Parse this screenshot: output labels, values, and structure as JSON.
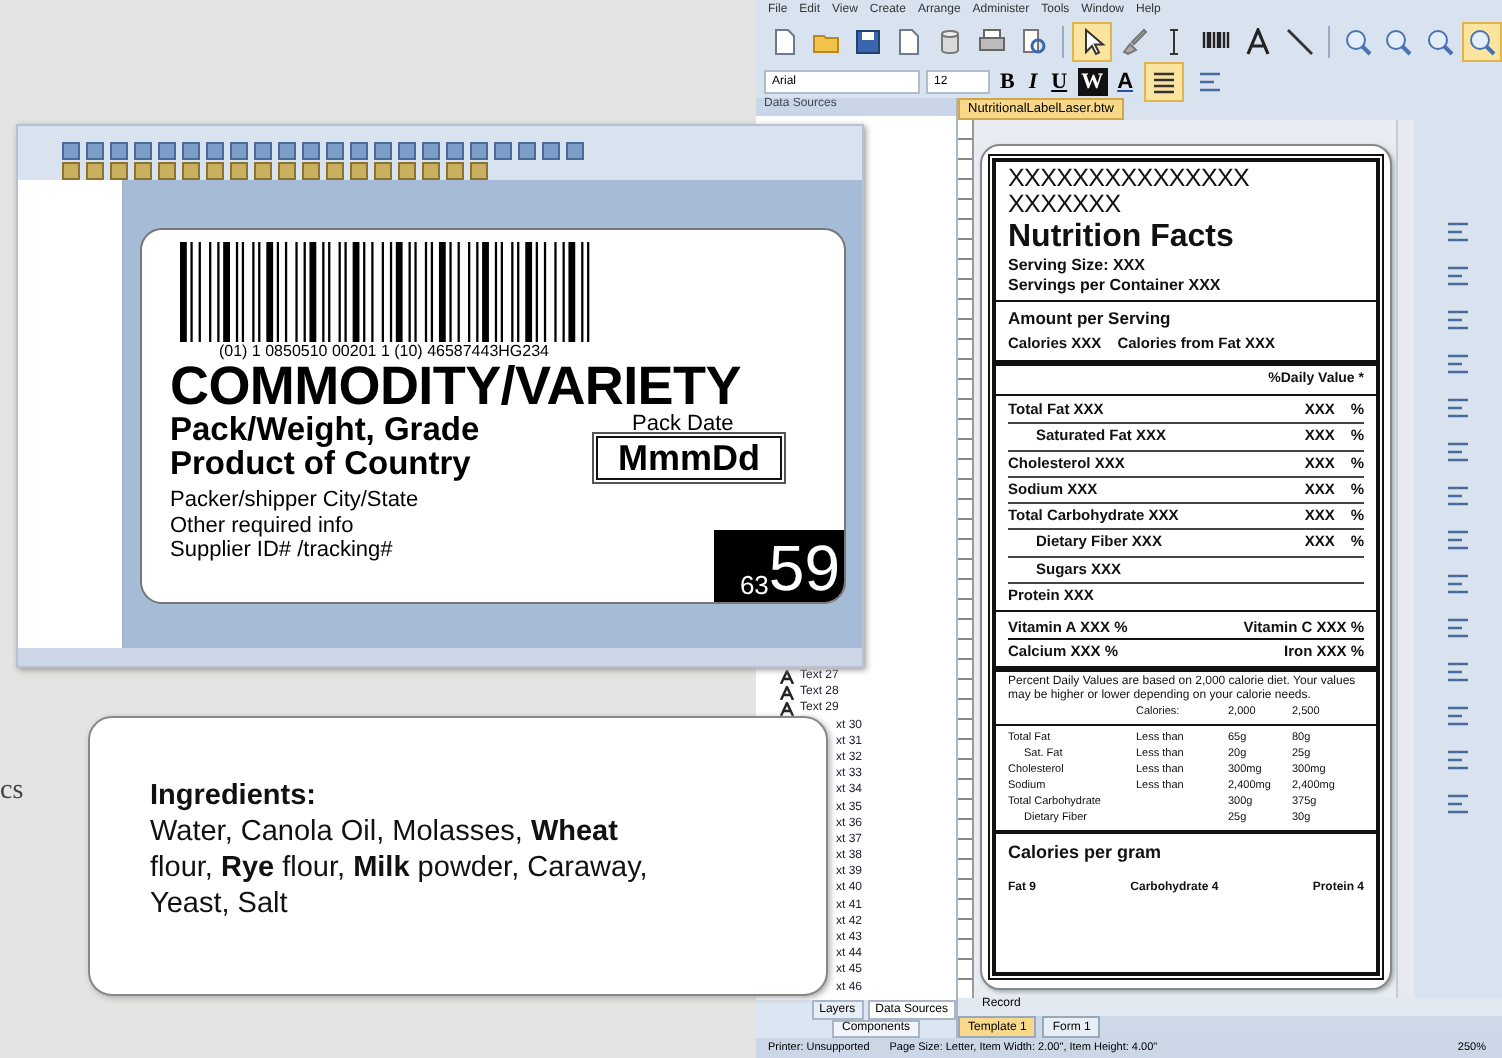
{
  "margin_text": "cs",
  "designer_window": {
    "menu": [
      "File",
      "Edit",
      "View",
      "Create",
      "Arrange",
      "Administer",
      "Tools",
      "Window",
      "Help"
    ],
    "drawing_tools": [
      {
        "selected": true
      },
      {
        "selected": false
      },
      {
        "selected": false
      },
      {
        "selected": false
      },
      {
        "selected": false
      },
      {
        "selected": false
      }
    ],
    "zoom_tools": [
      {
        "selected": false
      },
      {
        "selected": false
      },
      {
        "selected": false
      },
      {
        "selected": true
      }
    ],
    "font_name": "Arial",
    "font_size": "12",
    "bold_glyph": "B",
    "italic_glyph": "I",
    "underline_glyph": "U",
    "word_glyph": "W",
    "color_glyph": "A",
    "justify_selected": true,
    "panel_title": "Data Sources",
    "tree_items": [
      "Text 27",
      "Text 28",
      "Text 29"
    ],
    "tree_items_partial": [
      "xt 30",
      "xt 31",
      "xt 32",
      "xt 33",
      "xt 34",
      "xt 35",
      "xt 36",
      "xt 37",
      "xt 38",
      "xt 39",
      "xt 40",
      "xt 41",
      "xt 42",
      "xt 43",
      "xt 44",
      "xt 45",
      "xt 46"
    ],
    "panel_tabs": [
      {
        "label": "Layers",
        "selected": false
      },
      {
        "label": "Data Sources",
        "selected": true
      }
    ],
    "panel_footer": "Components",
    "document_tab": "NutritionalLabelLaser.btw",
    "record_label": "Record",
    "sheet_tabs": [
      {
        "label": "Template 1",
        "selected": true
      },
      {
        "label": "Form 1",
        "selected": false
      }
    ],
    "status": [
      "Printer: Unsupported",
      "Page Size: Letter, Item Width: 2.00\", Item Height: 4.00\""
    ],
    "zoom": "250%",
    "nutrition": {
      "header_lines": [
        "XXXXXXXXXXXXXXX",
        "XXXXXXX"
      ],
      "title": "Nutrition Facts",
      "serving_size": "Serving Size:  XXX",
      "servings": "Servings per Container   XXX",
      "amount_heading": "Amount per Serving",
      "calories": "Calories  XXX",
      "calories_fat": "Calories from Fat  XXX",
      "daily_value_heading": "%Daily Value *",
      "nutrients": [
        {
          "name": "Total Fat  XXX",
          "value": "XXX",
          "unit": "%",
          "indented": false
        },
        {
          "name": "Saturated Fat  XXX",
          "value": "XXX",
          "unit": "%",
          "indented": true
        },
        {
          "name": "Cholesterol  XXX",
          "value": "XXX",
          "unit": "%",
          "indented": false
        },
        {
          "name": "Sodium  XXX",
          "value": "XXX",
          "unit": "%",
          "indented": false
        },
        {
          "name": "Total Carbohydrate  XXX",
          "value": "XXX",
          "unit": "%",
          "indented": false
        },
        {
          "name": "Dietary Fiber  XXX",
          "value": "XXX",
          "unit": "%",
          "indented": true
        },
        {
          "name": "Sugars  XXX",
          "indented": true
        },
        {
          "name": "Protein  XXX",
          "indented": false
        }
      ],
      "vitamins": [
        [
          "Vitamin A  XXX  %",
          "Vitamin C  XXX  %"
        ],
        [
          "Calcium  XXX  %",
          "Iron  XXX   %"
        ]
      ],
      "footnote": "Percent Daily Values are based on 2,000 calorie diet. Your values may be higher or lower depending on your calorie needs.",
      "table_header": [
        "Calories:",
        "2,000",
        "2,500"
      ],
      "table_rows": [
        {
          "cells": [
            "Total Fat",
            "Less than",
            "65g",
            "80g"
          ],
          "indented": false
        },
        {
          "cells": [
            "Sat. Fat",
            "Less than",
            "20g",
            "25g"
          ],
          "indented": true
        },
        {
          "cells": [
            "Cholesterol",
            "Less than",
            "300mg",
            "300mg"
          ],
          "indented": false
        },
        {
          "cells": [
            "Sodium",
            "Less than",
            "2,400mg",
            "2,400mg"
          ],
          "indented": false
        },
        {
          "cells": [
            "Total Carbohydrate",
            "",
            "300g",
            "375g"
          ],
          "indented": false
        },
        {
          "cells": [
            "Dietary Fiber",
            "",
            "25g",
            "30g"
          ],
          "indented": true
        }
      ],
      "per_gram_heading": "Calories per gram",
      "per_gram": [
        "Fat 9",
        "Carbohydrate 4",
        "Protein 4"
      ]
    }
  },
  "produce_window": {
    "label": {
      "barcode_text": "(01) 1 0850510 00201 1 (10) 46587443HG234",
      "title": "COMMODITY/VARIETY",
      "lines": [
        "Pack/Weight, Grade",
        "Product of Country"
      ],
      "pack_date_label": "Pack Date",
      "pack_date": "MmmDd",
      "info": [
        "Packer/shipper   City/State",
        "Other required info",
        "Supplier ID# /tracking#"
      ],
      "code_small": "63",
      "code_large": "59"
    }
  },
  "ingredients_card": {
    "heading": "Ingredients:",
    "text": "Water, Canola Oil, Molasses, **Wheat** flour, **Rye** flour, **Milk** powder, Caraway, Yeast, Salt"
  }
}
